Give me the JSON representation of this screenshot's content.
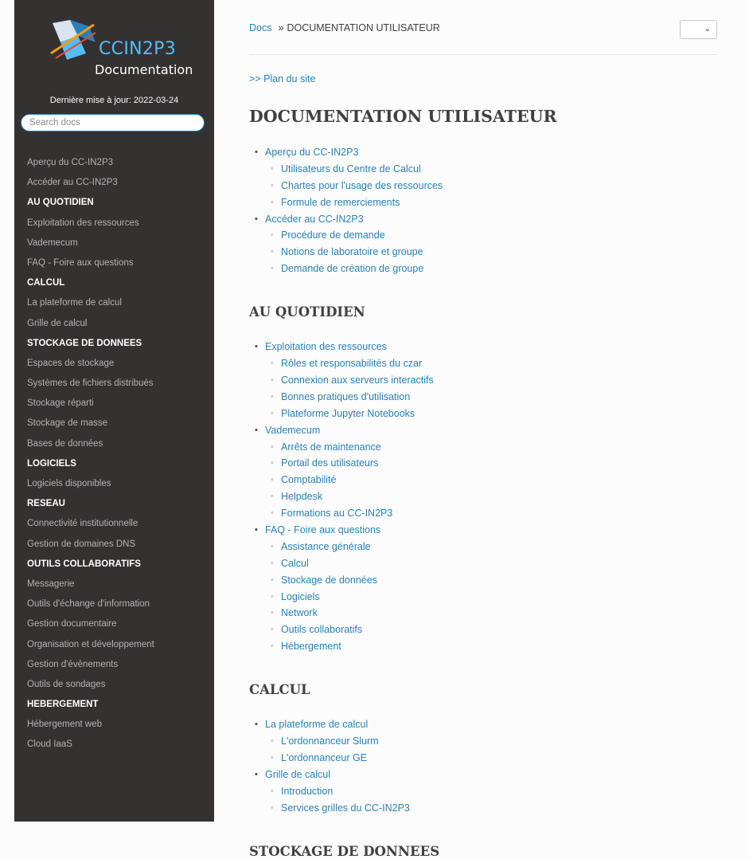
{
  "sidebar": {
    "logo_text": "CCIN2P3",
    "logo_subtitle": "Documentation",
    "last_update": "Dernière mise à jour: 2022-03-24",
    "search_placeholder": "Search docs",
    "menu": [
      {
        "type": "item",
        "label": "Aperçu du CC-IN2P3"
      },
      {
        "type": "item",
        "label": "Accéder au CC-IN2P3"
      },
      {
        "type": "caption",
        "label": "AU QUOTIDIEN"
      },
      {
        "type": "item",
        "label": "Exploitation des ressources"
      },
      {
        "type": "item",
        "label": "Vademecum"
      },
      {
        "type": "item",
        "label": "FAQ - Foire aux questions"
      },
      {
        "type": "caption",
        "label": "CALCUL"
      },
      {
        "type": "item",
        "label": "La plateforme de calcul"
      },
      {
        "type": "item",
        "label": "Grille de calcul"
      },
      {
        "type": "caption",
        "label": "STOCKAGE DE DONNEES"
      },
      {
        "type": "item",
        "label": "Espaces de stockage"
      },
      {
        "type": "item",
        "label": "Systèmes de fichiers distribués"
      },
      {
        "type": "item",
        "label": "Stockage réparti"
      },
      {
        "type": "item",
        "label": "Stockage de masse"
      },
      {
        "type": "item",
        "label": "Bases de données"
      },
      {
        "type": "caption",
        "label": "LOGICIELS"
      },
      {
        "type": "item",
        "label": "Logiciels disponibles"
      },
      {
        "type": "caption",
        "label": "RESEAU"
      },
      {
        "type": "item",
        "label": "Connectivité institutionnelle"
      },
      {
        "type": "item",
        "label": "Gestion de domaines DNS"
      },
      {
        "type": "caption",
        "label": "OUTILS COLLABORATIFS"
      },
      {
        "type": "item",
        "label": "Messagerie"
      },
      {
        "type": "item",
        "label": "Outils d'échange d'information"
      },
      {
        "type": "item",
        "label": "Gestion documentaire"
      },
      {
        "type": "item",
        "label": "Organisation et développement"
      },
      {
        "type": "item",
        "label": "Gestion d'évènements"
      },
      {
        "type": "item",
        "label": "Outils de sondages"
      },
      {
        "type": "caption",
        "label": "HEBERGEMENT"
      },
      {
        "type": "item",
        "label": "Hébergement web"
      },
      {
        "type": "item",
        "label": "Cloud IaaS"
      }
    ]
  },
  "breadcrumb": {
    "home": "Docs",
    "separator": "»",
    "current": "DOCUMENTATION UTILISATEUR"
  },
  "sitemap_link": ">> Plan du site",
  "page_title": "DOCUMENTATION UTILISATEUR",
  "sections": [
    {
      "title": "",
      "items": [
        {
          "label": "Aperçu du CC-IN2P3",
          "children": [
            "Utilisateurs du Centre de Calcul",
            "Chartes pour l'usage des ressources",
            "Formule de remerciements"
          ]
        },
        {
          "label": "Accéder au CC-IN2P3",
          "children": [
            "Procédure de demande",
            "Notions de laboratoire et groupe",
            "Demande de création de groupe"
          ]
        }
      ]
    },
    {
      "title": "AU QUOTIDIEN",
      "items": [
        {
          "label": "Exploitation des ressources",
          "children": [
            "Rôles et responsabilités du czar",
            "Connexion aux serveurs interactifs",
            "Bonnes pratiques d'utilisation",
            "Plateforme Jupyter Notebooks"
          ]
        },
        {
          "label": "Vademecum",
          "children": [
            "Arrêts de maintenance",
            "Portail des utilisateurs",
            "Comptabilité",
            "Helpdesk",
            "Formations au CC-IN2P3"
          ]
        },
        {
          "label": "FAQ - Foire aux questions",
          "children": [
            "Assistance générale",
            "Calcul",
            "Stockage de données",
            "Logiciels",
            "Network",
            "Outils collaboratifs",
            "Hébergement"
          ]
        }
      ]
    },
    {
      "title": "CALCUL",
      "items": [
        {
          "label": "La plateforme de calcul",
          "children": [
            "L'ordonnanceur Slurm",
            "L'ordonnanceur GE"
          ]
        },
        {
          "label": "Grille de calcul",
          "children": [
            "Introduction",
            "Services grilles du CC-IN2P3"
          ]
        }
      ]
    },
    {
      "title": "STOCKAGE DE DONNEES",
      "items": []
    }
  ]
}
